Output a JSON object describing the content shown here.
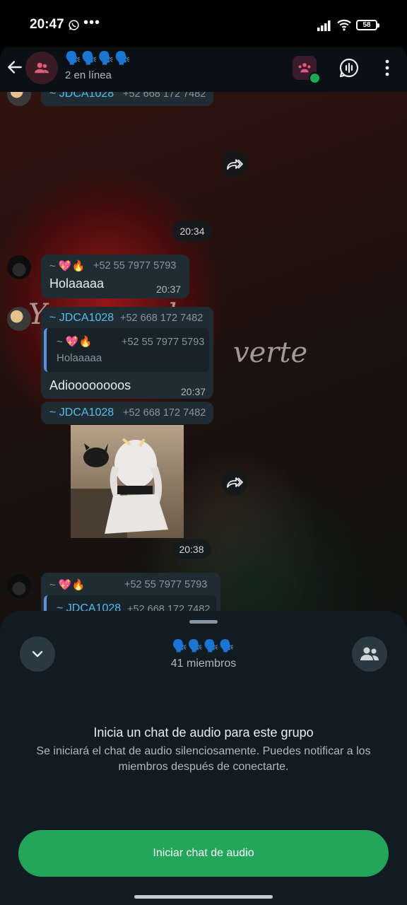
{
  "status_bar": {
    "time": "20:47",
    "dots": "•••",
    "battery": "58"
  },
  "header": {
    "group_name": "🗣️🗣️🗣️🗣️",
    "status": "2 en línea"
  },
  "messages": [
    {
      "sender": "~ JDCA1028",
      "phone": "+52 668 172 7482"
    },
    {
      "time_pill": "20:34"
    },
    {
      "sender": "~ 💖🔥",
      "phone": "+52 55 7977 5793",
      "text": "Holaaaaa",
      "time": "20:37"
    },
    {
      "sender": "~ JDCA1028",
      "phone": "+52 668 172 7482",
      "quote": {
        "sender": "~ 💖🔥",
        "phone": "+52 55 7977 5793",
        "text": "Holaaaaa"
      },
      "text": "Adioooooooos",
      "time": "20:37"
    },
    {
      "sender": "~ JDCA1028",
      "phone": "+52 668 172 7482",
      "time_pill": "20:38"
    },
    {
      "sender": "~ 💖🔥",
      "phone": "+52 55 7977 5793",
      "quote": {
        "sender": "~ JDCA1028",
        "phone": "+52 668 172 7482"
      }
    }
  ],
  "wallpaper": {
    "line1": "Y      o recordar,",
    "line2": "verte"
  },
  "sheet": {
    "group_name": "🗣️🗣️🗣️🗣️",
    "members": "41 miembros",
    "heading": "Inicia un chat de audio para este grupo",
    "description": "Se iniciará el chat de audio silenciosamente. Puedes notificar a los miembros después de conectarte.",
    "button": "Iniciar chat de audio"
  },
  "colors": {
    "accent_green": "#21a65a",
    "sender_blue": "#53bdeb",
    "bubble": "#1f2c34",
    "sheet": "#121b22"
  }
}
